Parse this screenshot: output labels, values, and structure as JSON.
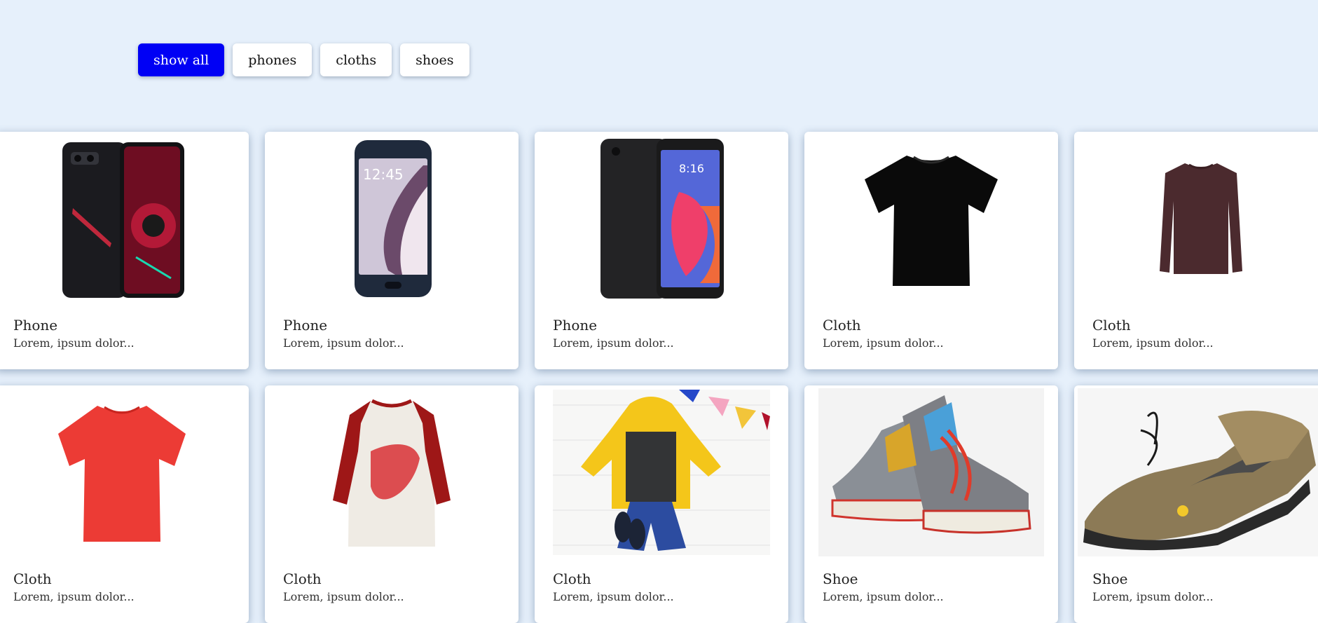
{
  "filters": {
    "show_all": "show all",
    "phones": "phones",
    "cloths": "cloths",
    "shoes": "shoes",
    "active": "show all"
  },
  "products": [
    {
      "title": "Phone",
      "desc": "Lorem, ipsum dolor...",
      "image": "gaming-phone-icon"
    },
    {
      "title": "Phone",
      "desc": "Lorem, ipsum dolor...",
      "image": "samsung-phone-icon"
    },
    {
      "title": "Phone",
      "desc": "Lorem, ipsum dolor...",
      "image": "redmi-phone-icon"
    },
    {
      "title": "Cloth",
      "desc": "Lorem, ipsum dolor...",
      "image": "black-tshirt-icon"
    },
    {
      "title": "Cloth",
      "desc": "Lorem, ipsum dolor...",
      "image": "maroon-sweater-icon"
    },
    {
      "title": "Cloth",
      "desc": "Lorem, ipsum dolor...",
      "image": "red-tshirt-icon"
    },
    {
      "title": "Cloth",
      "desc": "Lorem, ipsum dolor...",
      "image": "raglan-shirt-icon"
    },
    {
      "title": "Cloth",
      "desc": "Lorem, ipsum dolor...",
      "image": "kids-outfit-icon"
    },
    {
      "title": "Shoe",
      "desc": "Lorem, ipsum dolor...",
      "image": "sneakers-icon"
    },
    {
      "title": "Shoe",
      "desc": "Lorem, ipsum dolor...",
      "image": "hiking-shoes-icon"
    }
  ],
  "colors": {
    "background": "#e6f0fb",
    "accent": "#0000f5"
  }
}
